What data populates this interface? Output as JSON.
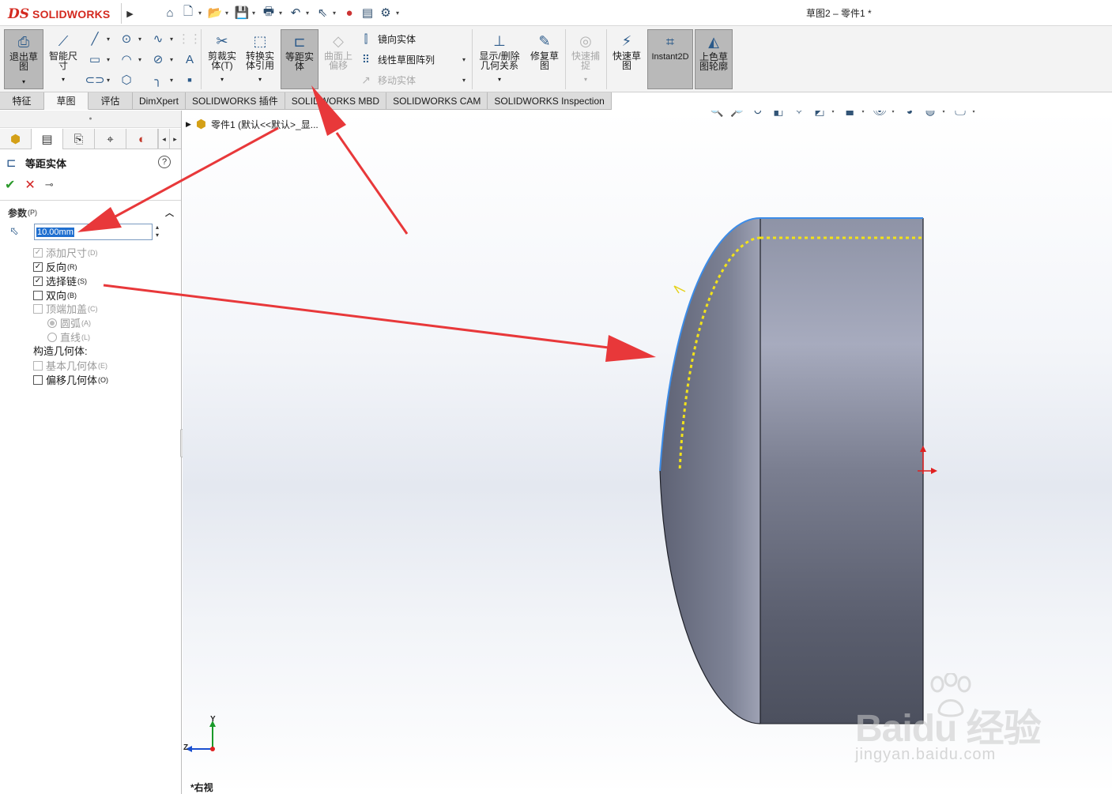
{
  "app": {
    "brand_ds": "DS",
    "brand_name": "SOLIDWORKS",
    "doc_title": "草图2 – 零件1 *"
  },
  "quickbar": {
    "icons": [
      "home-icon",
      "new-document-icon",
      "open-icon",
      "save-icon",
      "print-icon",
      "undo-icon",
      "select-icon",
      "traffic-light-icon",
      "file-properties-icon",
      "options-gear-icon"
    ]
  },
  "ribbon": {
    "exit_sketch": "退出草\n图",
    "smart_dimension": "智能尺\n寸",
    "trim": "剪裁实\n体(T)",
    "convert": "转换实\n体引用",
    "offset": "等距实\n体",
    "surface_offset": "曲面上\n偏移",
    "mirror": "镜向实体",
    "linear_pattern": "线性草图阵列",
    "move": "移动实体",
    "show_relations": "显示/删除\n几何关系",
    "repair": "修复草\n图",
    "quick_snap": "快速捕\n捉",
    "rapid_sketch": "快速草\n图",
    "instant2d": "Instant2D",
    "shaded_contours": "上色草\n图轮廓"
  },
  "tabs": [
    {
      "label": "特征",
      "active": false
    },
    {
      "label": "草图",
      "active": true
    },
    {
      "label": "评估",
      "active": false
    },
    {
      "label": "DimXpert",
      "active": false
    },
    {
      "label": "SOLIDWORKS 插件",
      "active": false
    },
    {
      "label": "SOLIDWORKS MBD",
      "active": false
    },
    {
      "label": "SOLIDWORKS CAM",
      "active": false
    },
    {
      "label": "SOLIDWORKS Inspection",
      "active": false
    }
  ],
  "property_manager": {
    "title": "等距实体",
    "help": "?",
    "ok": "✔",
    "cancel": "✕",
    "pin": "⊸",
    "group": "参数",
    "group_key": "(P)",
    "distance_value": "10.00mm",
    "options": {
      "add_dimension": {
        "label": "添加尺寸",
        "key": "(D)",
        "checked": true,
        "enabled": false
      },
      "reverse": {
        "label": "反向",
        "key": "(R)",
        "checked": true,
        "enabled": true
      },
      "select_chain": {
        "label": "选择链",
        "key": "(S)",
        "checked": true,
        "enabled": true
      },
      "bidirectional": {
        "label": "双向",
        "key": "(B)",
        "checked": false,
        "enabled": true
      },
      "cap_ends": {
        "label": "顶端加盖",
        "key": "(C)",
        "checked": false,
        "enabled": false
      },
      "arcs": {
        "label": "圆弧",
        "key": "(A)",
        "enabled": false
      },
      "lines": {
        "label": "直线",
        "key": "(L)",
        "enabled": false
      }
    },
    "construction_label": "构造几何体:",
    "base_geometry": {
      "label": "基本几何体",
      "key": "(E)",
      "checked": false,
      "enabled": false
    },
    "offset_geometry": {
      "label": "偏移几何体",
      "key": "(O)",
      "checked": false,
      "enabled": true
    }
  },
  "viewport": {
    "tree_item": "零件1  (默认<<默认>_显...",
    "view_name": "*右视",
    "triad_y": "Y",
    "triad_z": "Z"
  },
  "watermark": {
    "brand": "Baidu 经验",
    "url": "jingyan.baidu.com"
  },
  "colors": {
    "accent_red": "#e8383a",
    "sketch_blue": "#3c8ce8",
    "offset_yellow": "#f2e21a",
    "active_button_bg": "#b9b9b9",
    "model_body": "#5b6070"
  }
}
